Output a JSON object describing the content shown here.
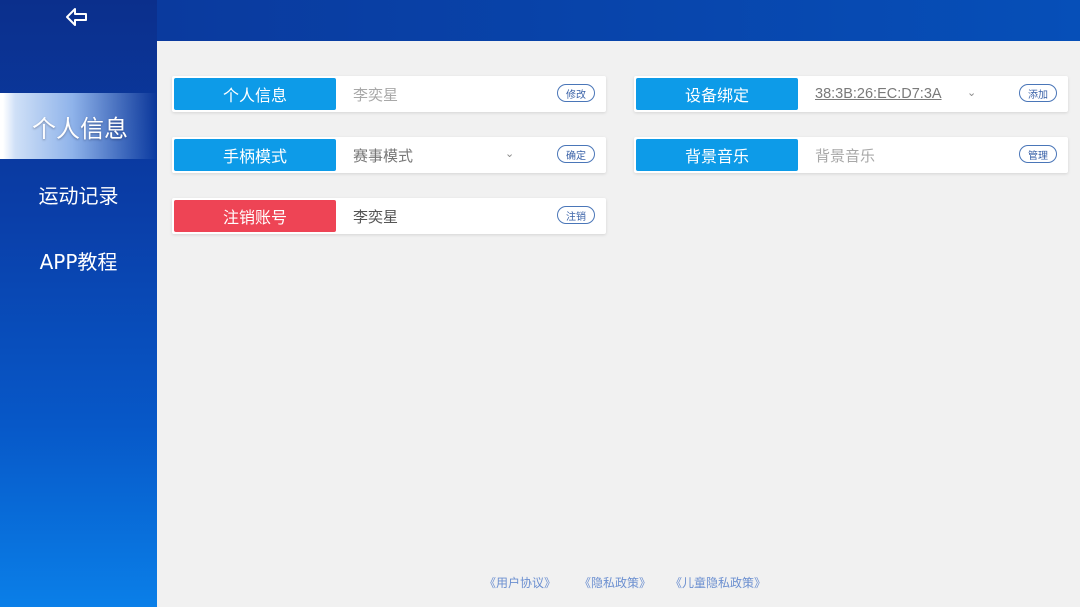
{
  "sidebar": {
    "back_icon": "back-arrow-icon",
    "items": [
      {
        "label": "个人信息",
        "active": true
      },
      {
        "label": "运动记录",
        "active": false
      },
      {
        "label": "APP教程",
        "active": false
      }
    ]
  },
  "cards": {
    "personal_info": {
      "label": "个人信息",
      "value": "李奕星",
      "action": "修改"
    },
    "device_binding": {
      "label": "设备绑定",
      "value": "38:3B:26:EC:D7:3A",
      "action": "添加"
    },
    "controller_mode": {
      "label": "手柄模式",
      "value": "赛事模式",
      "action": "确定"
    },
    "bg_music": {
      "label": "背景音乐",
      "value": "背景音乐",
      "action": "管理"
    },
    "deregister": {
      "label": "注销账号",
      "value": "李奕星",
      "action": "注销"
    }
  },
  "footer": {
    "user_agreement": "《用户协议》",
    "privacy_policy": "《隐私政策》",
    "child_privacy_policy": "《儿童隐私政策》"
  },
  "colors": {
    "accent": "#0d9be8",
    "danger": "#ee4455",
    "sidebar_top": "#0b2f8c",
    "sidebar_bottom": "#0a7fe8"
  }
}
